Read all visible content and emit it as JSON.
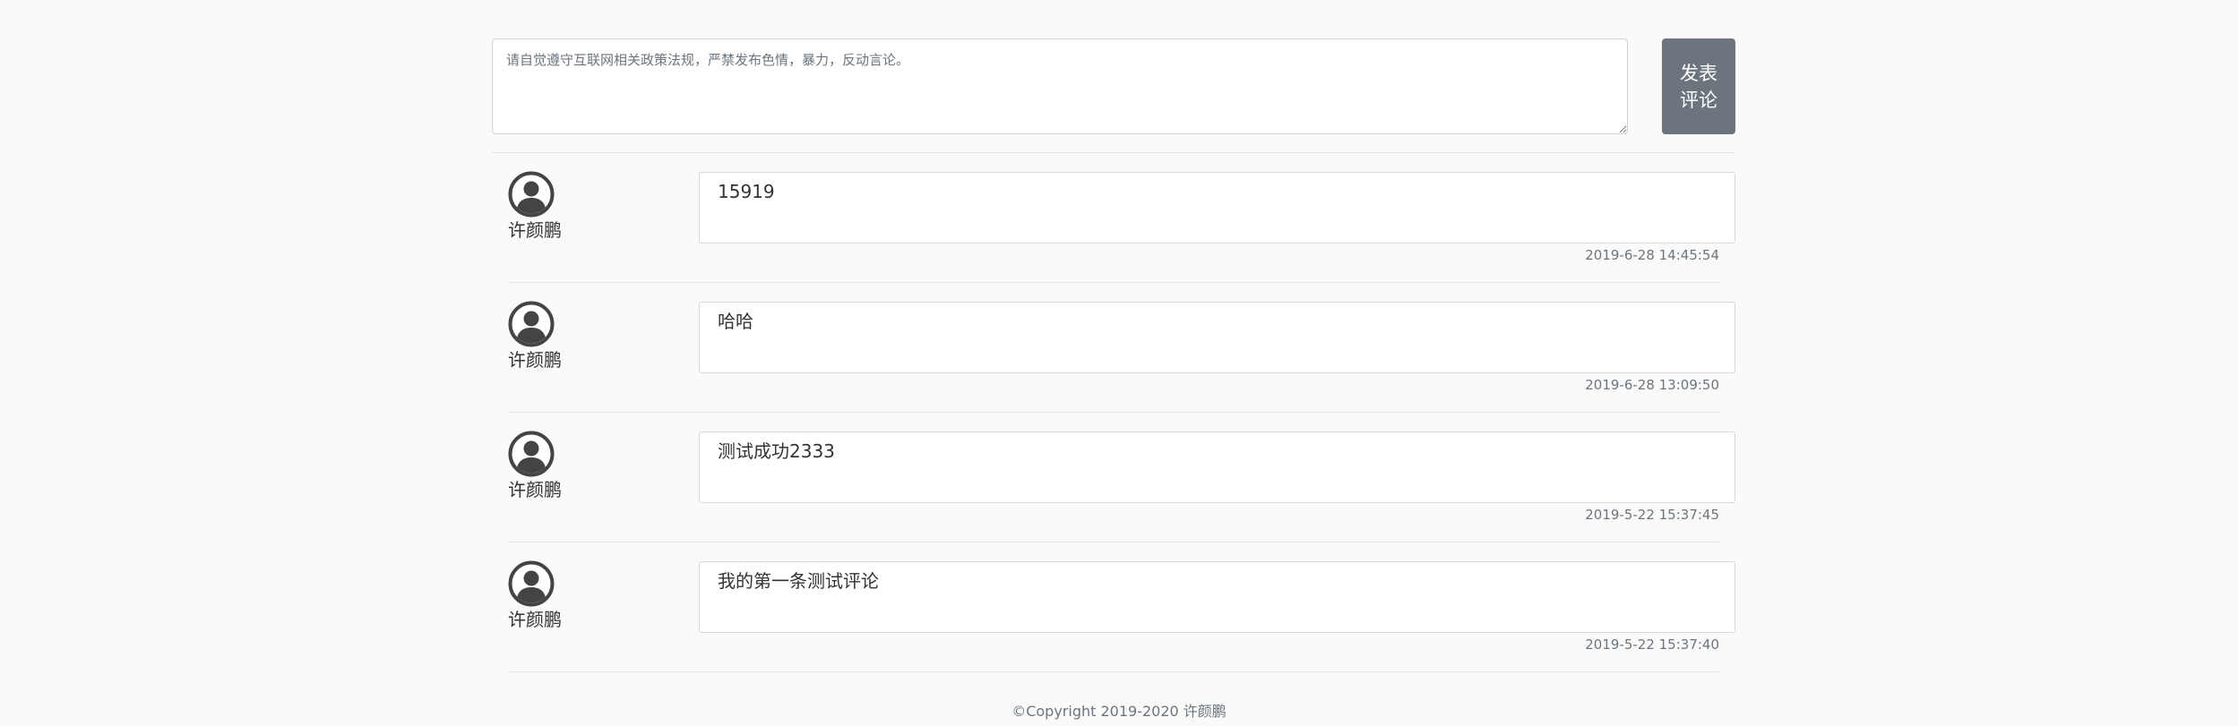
{
  "composer": {
    "placeholder": "请自觉遵守互联网相关政策法规，严禁发布色情，暴力，反动言论。",
    "value": "",
    "post_button": {
      "line1": "发表",
      "line2": "评论"
    }
  },
  "comments": [
    {
      "avatar_icon": "user-avatar-icon",
      "author": "许颜鹏",
      "content": "15919",
      "time": "2019-6-28 14:45:54"
    },
    {
      "avatar_icon": "user-avatar-icon",
      "author": "许颜鹏",
      "content": "哈哈",
      "time": "2019-6-28 13:09:50"
    },
    {
      "avatar_icon": "user-avatar-icon",
      "author": "许颜鹏",
      "content": "测试成功2333",
      "time": "2019-5-22 15:37:45"
    },
    {
      "avatar_icon": "user-avatar-icon",
      "author": "许颜鹏",
      "content": "我的第一条测试评论",
      "time": "2019-5-22 15:37:40"
    }
  ],
  "footer": {
    "copyright": "©Copyright 2019-2020 许颜鹏"
  },
  "colors": {
    "button_bg": "#6c757d",
    "page_bg": "#fafafa",
    "border": "#d9d9d9",
    "muted_text": "#6c757d"
  }
}
